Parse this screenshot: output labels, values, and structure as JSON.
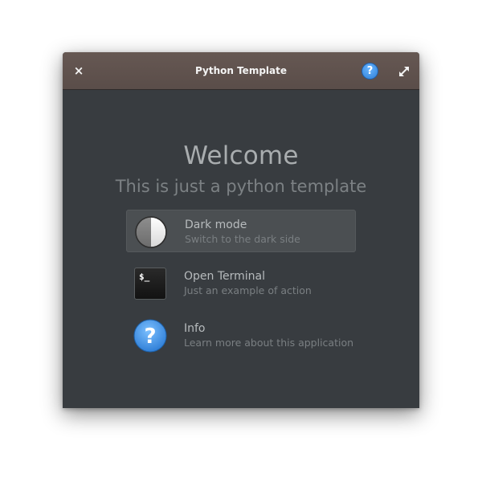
{
  "window": {
    "title": "Python Template",
    "close_glyph": "×",
    "help_glyph": "?"
  },
  "welcome": {
    "title": "Welcome",
    "subtitle": "This is just a python template"
  },
  "actions": [
    {
      "label": "Dark mode",
      "description": "Switch to the dark side",
      "icon": "dark-mode-toggle-icon",
      "selected": true
    },
    {
      "label": "Open Terminal",
      "description": "Just an example of action",
      "icon": "terminal-icon",
      "icon_text": "$_",
      "selected": false
    },
    {
      "label": "Info",
      "description": "Learn more about this application",
      "icon": "help-icon",
      "selected": false
    }
  ],
  "colors": {
    "titlebar": "#5f524e",
    "window_background": "#383c40",
    "accent_blue": "#3a8ee6"
  }
}
